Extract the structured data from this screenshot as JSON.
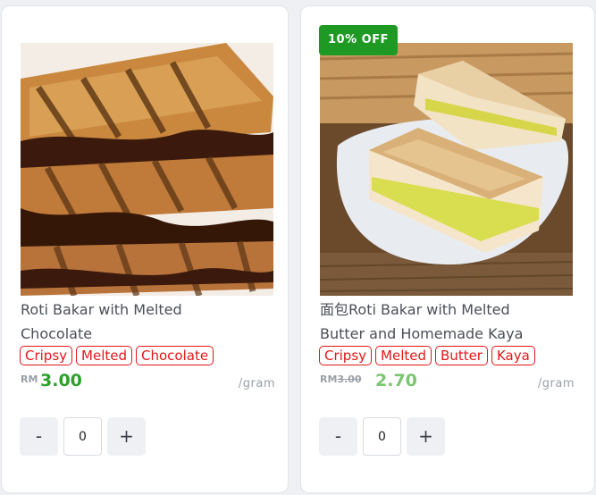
{
  "products": [
    {
      "badge": "",
      "title_line1": "Roti Bakar with Melted",
      "title_line2": "Chocolate",
      "tags": [
        "Cripsy",
        "Melted",
        "Chocolate"
      ],
      "currency": "RM",
      "old_price": "",
      "price": "3.00",
      "unit": "/gram",
      "qty": "0",
      "minus_label": "-",
      "plus_label": "+",
      "image_icon": "chocolate-toast-image"
    },
    {
      "badge": "10% OFF",
      "title_line1": "面包Roti Bakar with Melted",
      "title_line2": "Butter and Homemade Kaya",
      "tags": [
        "Cripsy",
        "Melted",
        "Butter",
        "Kaya"
      ],
      "currency": "RM",
      "old_price": "3.00",
      "price": "2.70",
      "unit": "/gram",
      "qty": "0",
      "minus_label": "-",
      "plus_label": "+",
      "image_icon": "kaya-toast-image"
    }
  ],
  "colors": {
    "tag": "#e01818",
    "price_regular": "#2ea02e",
    "price_discount": "#7ac570",
    "badge": "#1e9a24"
  }
}
